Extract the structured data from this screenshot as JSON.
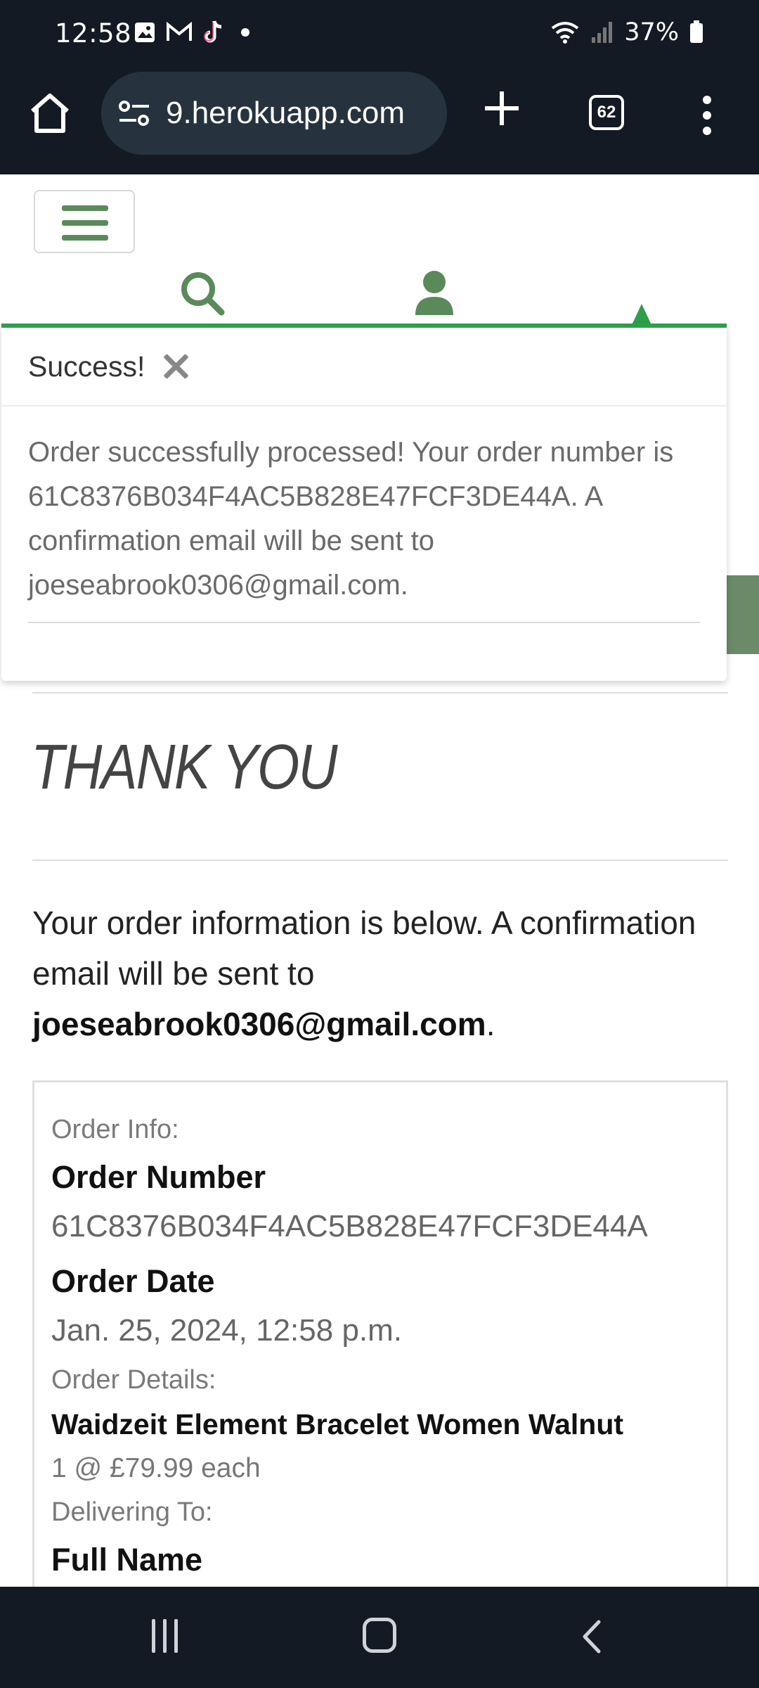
{
  "status_bar": {
    "time": "12:58",
    "battery": "37%",
    "icons": [
      "image-icon",
      "gmail-icon",
      "tiktok-icon",
      "dot-icon",
      "wifi-icon",
      "signal-icon",
      "battery-icon"
    ]
  },
  "browser": {
    "url": "9.herokuapp.com",
    "tab_count": "62"
  },
  "toast": {
    "title": "Success!",
    "message": "Order successfully processed! Your order number is 61C8376B034F4AC5B828E47FCF3DE44A. A confirmation email will be sent to joeseabrook0306@gmail.com."
  },
  "page": {
    "heading": "THANK YOU",
    "intro_text": "Your order information is below. A confirmation email will be sent to",
    "intro_email": "joeseabrook0306@gmail.com",
    "intro_period": "."
  },
  "order": {
    "info_label": "Order Info:",
    "number_label": "Order Number",
    "number_value": "61C8376B034F4AC5B828E47FCF3DE44A",
    "date_label": "Order Date",
    "date_value": "Jan. 25, 2024, 12:58 p.m.",
    "details_label": "Order Details:",
    "item_name": "Waidzeit Element Bracelet Women Walnut",
    "item_qty": "1 @ £79.99 each",
    "delivering_label": "Delivering To:",
    "full_name_label": "Full Name"
  },
  "colors": {
    "accent": "#2e9e4a",
    "brand_green": "#5a8a5a",
    "system_bar": "#131a23"
  }
}
